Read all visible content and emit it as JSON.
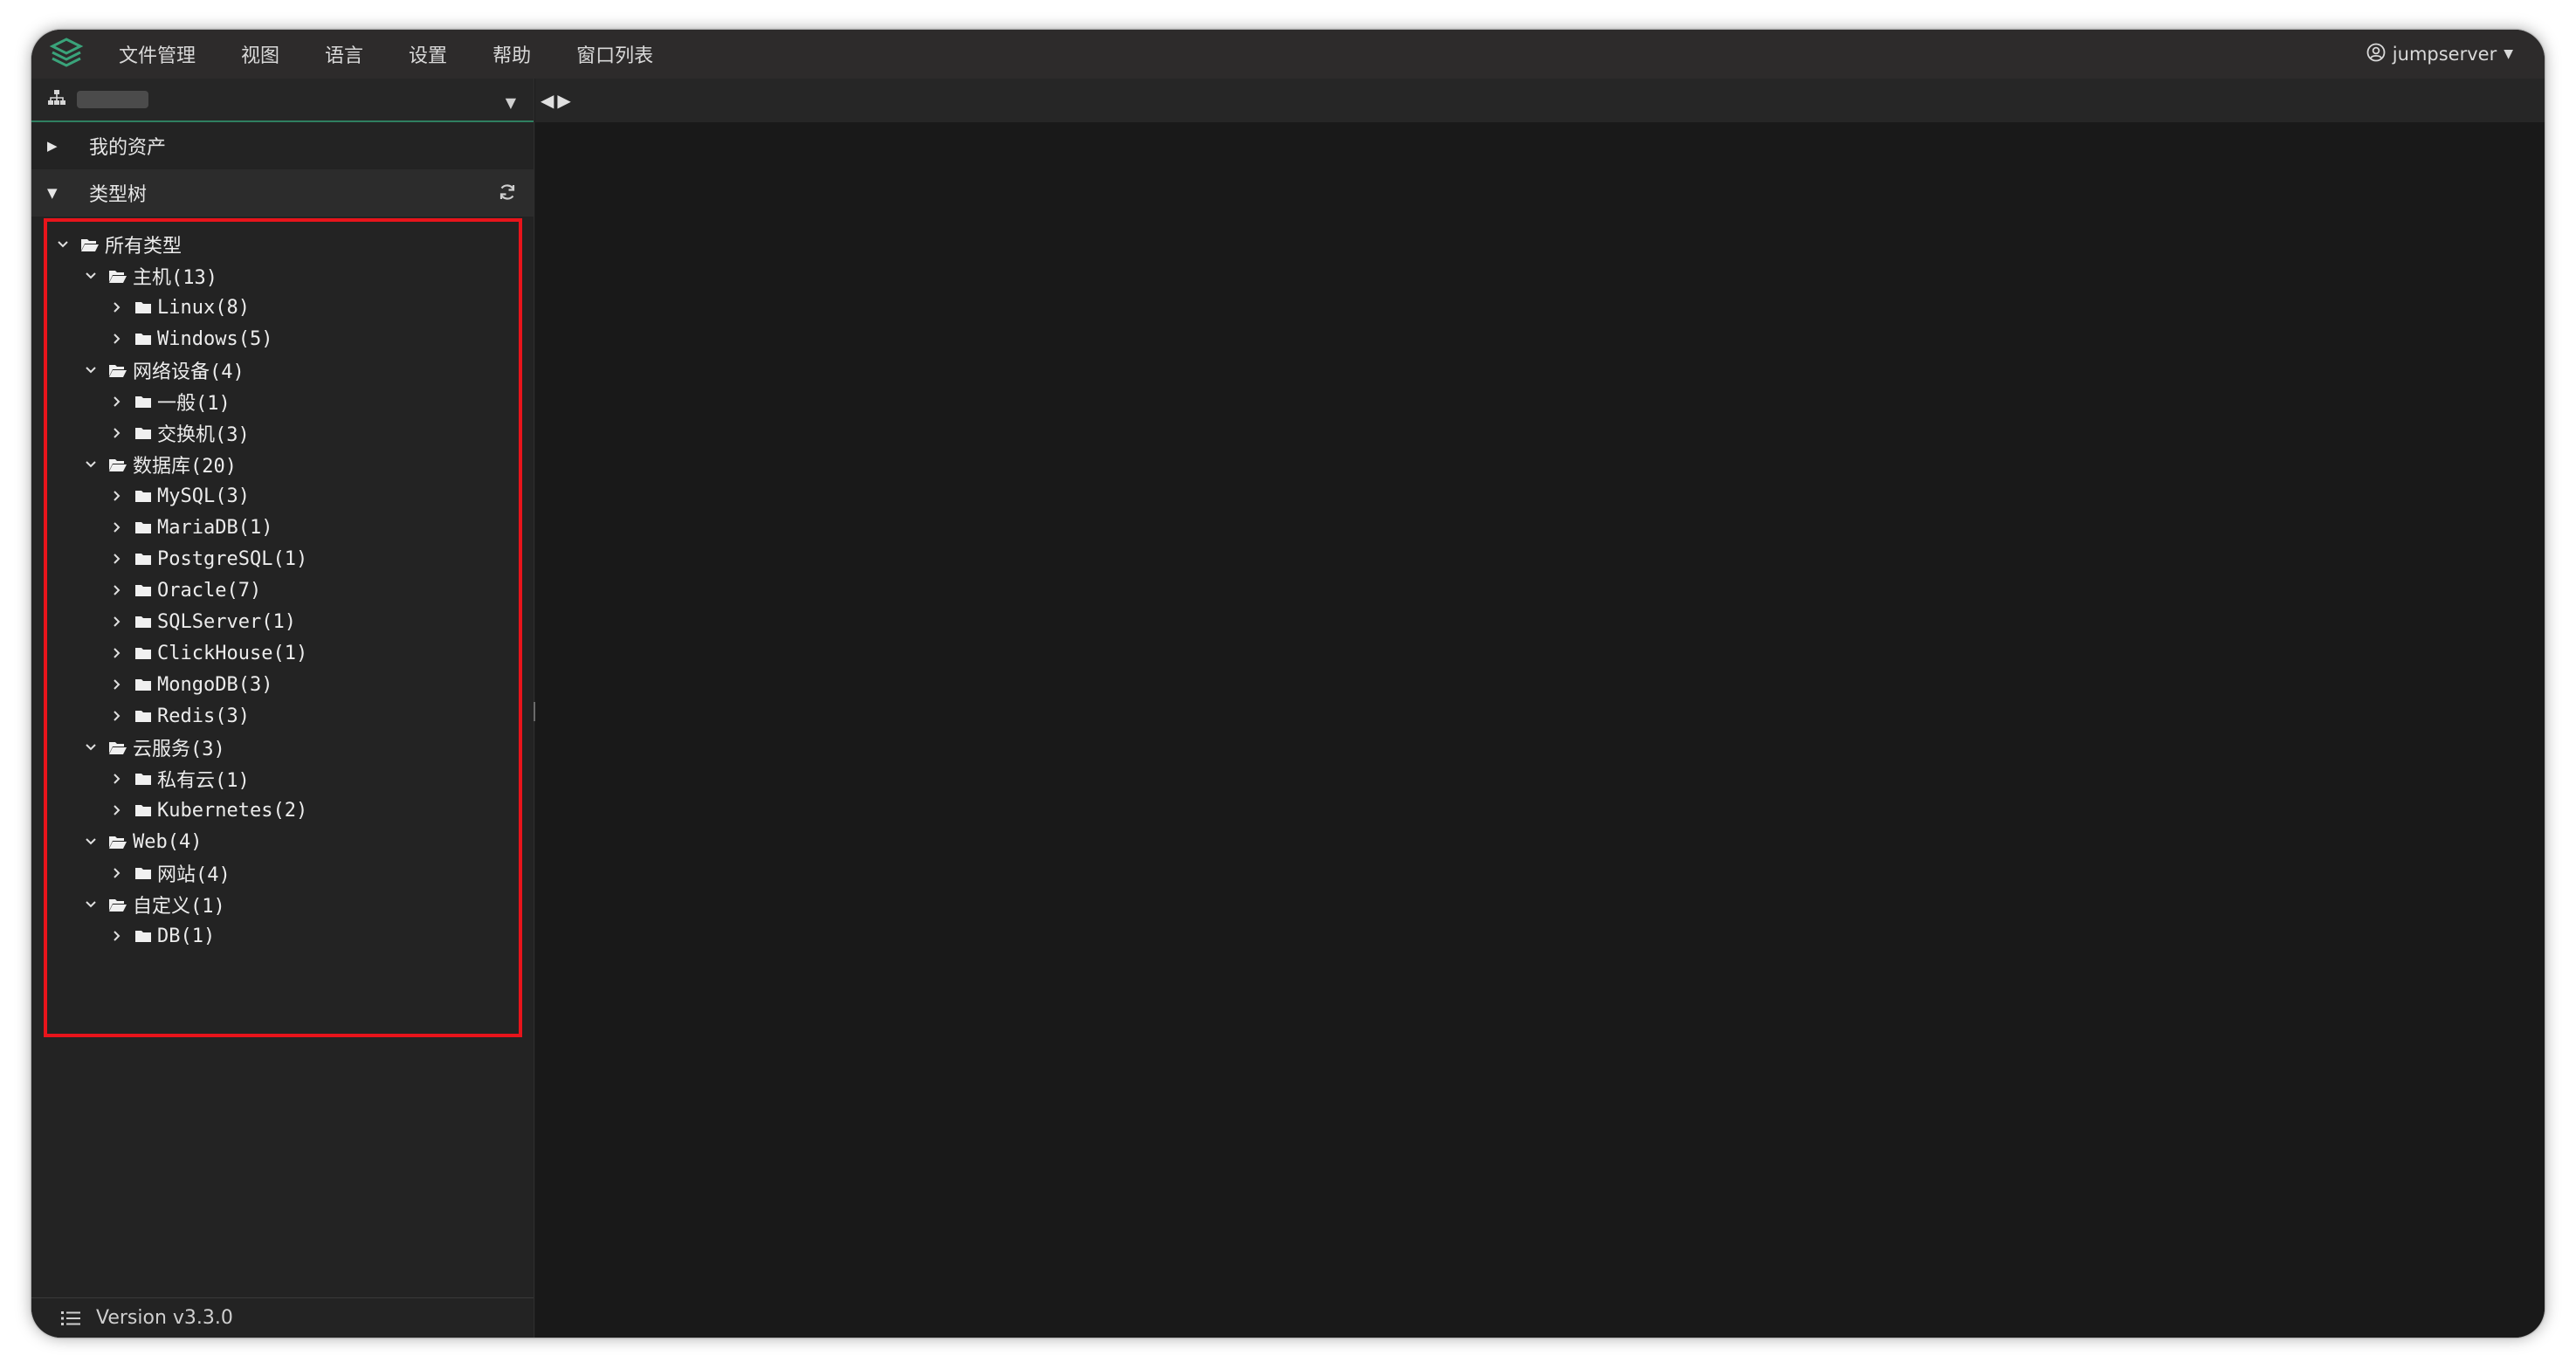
{
  "menubar": {
    "items": [
      "文件管理",
      "视图",
      "语言",
      "设置",
      "帮助",
      "窗口列表"
    ],
    "user": "jumpserver"
  },
  "sidebar": {
    "sections": [
      {
        "label": "我的资产",
        "expanded": false
      },
      {
        "label": "类型树",
        "expanded": true
      }
    ],
    "tree": [
      {
        "label": "所有类型",
        "level": 0,
        "open": true
      },
      {
        "label": "主机(13)",
        "level": 1,
        "open": true
      },
      {
        "label": "Linux(8)",
        "level": 2,
        "open": false
      },
      {
        "label": "Windows(5)",
        "level": 2,
        "open": false
      },
      {
        "label": "网络设备(4)",
        "level": 1,
        "open": true
      },
      {
        "label": "一般(1)",
        "level": 2,
        "open": false
      },
      {
        "label": "交换机(3)",
        "level": 2,
        "open": false
      },
      {
        "label": "数据库(20)",
        "level": 1,
        "open": true
      },
      {
        "label": "MySQL(3)",
        "level": 2,
        "open": false
      },
      {
        "label": "MariaDB(1)",
        "level": 2,
        "open": false
      },
      {
        "label": "PostgreSQL(1)",
        "level": 2,
        "open": false
      },
      {
        "label": "Oracle(7)",
        "level": 2,
        "open": false
      },
      {
        "label": "SQLServer(1)",
        "level": 2,
        "open": false
      },
      {
        "label": "ClickHouse(1)",
        "level": 2,
        "open": false
      },
      {
        "label": "MongoDB(3)",
        "level": 2,
        "open": false
      },
      {
        "label": "Redis(3)",
        "level": 2,
        "open": false
      },
      {
        "label": "云服务(3)",
        "level": 1,
        "open": true
      },
      {
        "label": "私有云(1)",
        "level": 2,
        "open": false
      },
      {
        "label": "Kubernetes(2)",
        "level": 2,
        "open": false
      },
      {
        "label": "Web(4)",
        "level": 1,
        "open": true
      },
      {
        "label": "网站(4)",
        "level": 2,
        "open": false
      },
      {
        "label": "自定义(1)",
        "level": 1,
        "open": true
      },
      {
        "label": "DB(1)",
        "level": 2,
        "open": false
      }
    ],
    "version": "Version v3.3.0"
  },
  "colors": {
    "accent": "#2f7f60",
    "highlight": "#e8141b",
    "logo": "#3aa37a"
  }
}
